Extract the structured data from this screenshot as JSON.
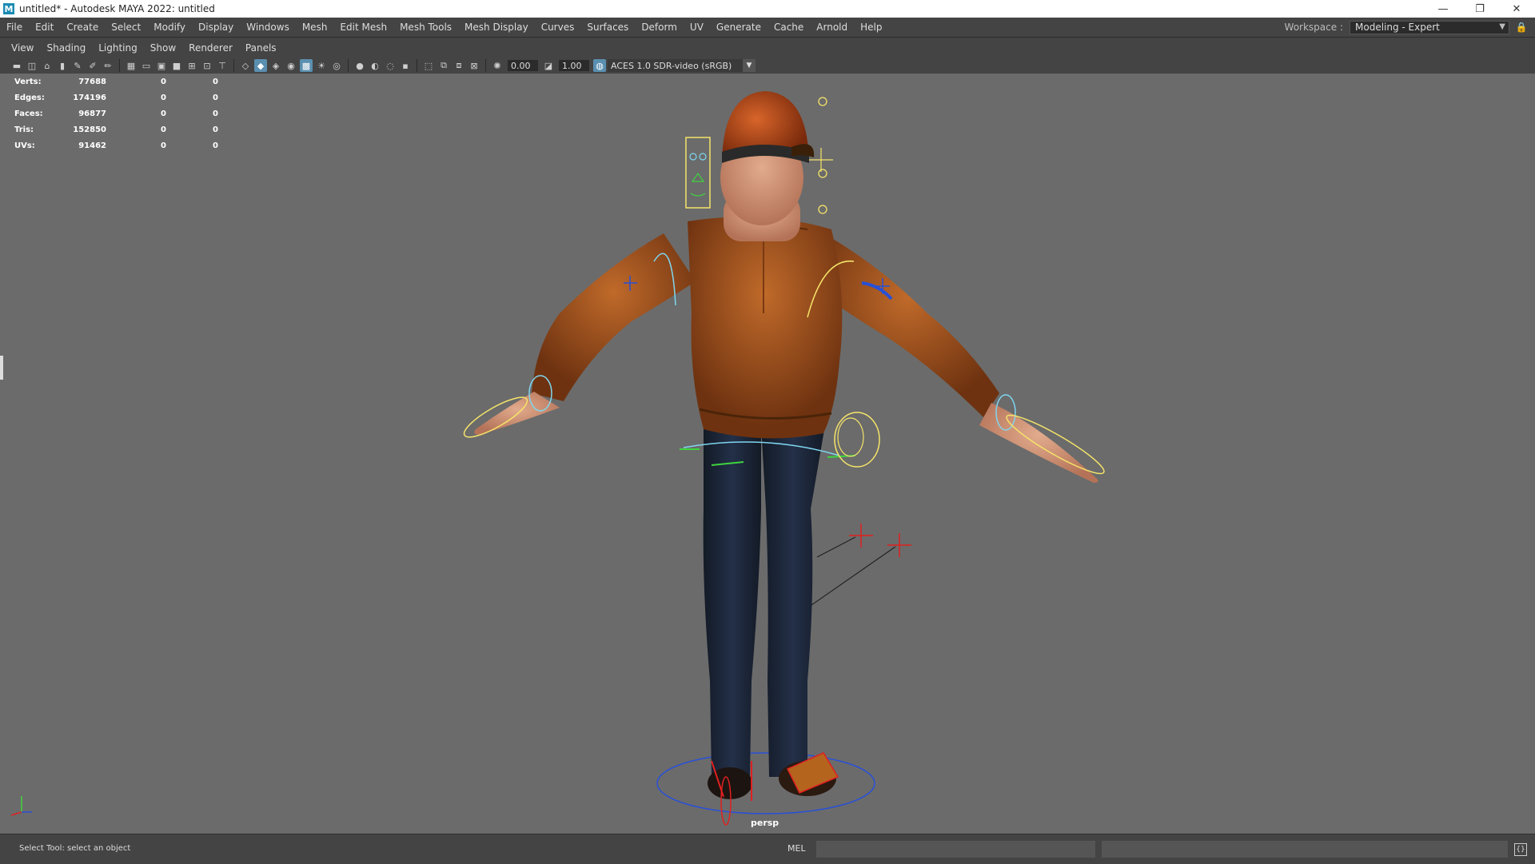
{
  "window": {
    "title": "untitled* - Autodesk MAYA 2022: untitled",
    "logo": "M",
    "controls": [
      "—",
      "❐",
      "✕"
    ]
  },
  "menu": [
    "File",
    "Edit",
    "Create",
    "Select",
    "Modify",
    "Display",
    "Windows",
    "Mesh",
    "Edit Mesh",
    "Mesh Tools",
    "Mesh Display",
    "Curves",
    "Surfaces",
    "Deform",
    "UV",
    "Generate",
    "Cache",
    "Arnold",
    "Help"
  ],
  "workspace": {
    "label": "Workspace :",
    "value": "Modeling - Expert"
  },
  "panel_menu": [
    "View",
    "Shading",
    "Lighting",
    "Show",
    "Renderer",
    "Panels"
  ],
  "toolbar": {
    "exposure": "0.00",
    "gamma": "1.00",
    "color_space": "ACES 1.0 SDR-video (sRGB)"
  },
  "hud": [
    {
      "label": "Verts:",
      "v1": "77688",
      "v2": "0",
      "v3": "0"
    },
    {
      "label": "Edges:",
      "v1": "174196",
      "v2": "0",
      "v3": "0"
    },
    {
      "label": "Faces:",
      "v1": "96877",
      "v2": "0",
      "v3": "0"
    },
    {
      "label": "Tris:",
      "v1": "152850",
      "v2": "0",
      "v3": "0"
    },
    {
      "label": "UVs:",
      "v1": "91462",
      "v2": "0",
      "v3": "0"
    }
  ],
  "camera_label": "persp",
  "status": {
    "help_line": "Select Tool: select an object",
    "command_type": "MEL"
  },
  "colors": {
    "viewport_bg": "#6b6b6b",
    "jacket": "#a4551c",
    "jeans": "#1a2233",
    "skin": "#d79a7a",
    "control_yellow": "#f5e46a",
    "control_cyan": "#7fd6f0",
    "control_green": "#3fd43f",
    "control_red": "#e02020",
    "control_blue": "#2850d8"
  }
}
